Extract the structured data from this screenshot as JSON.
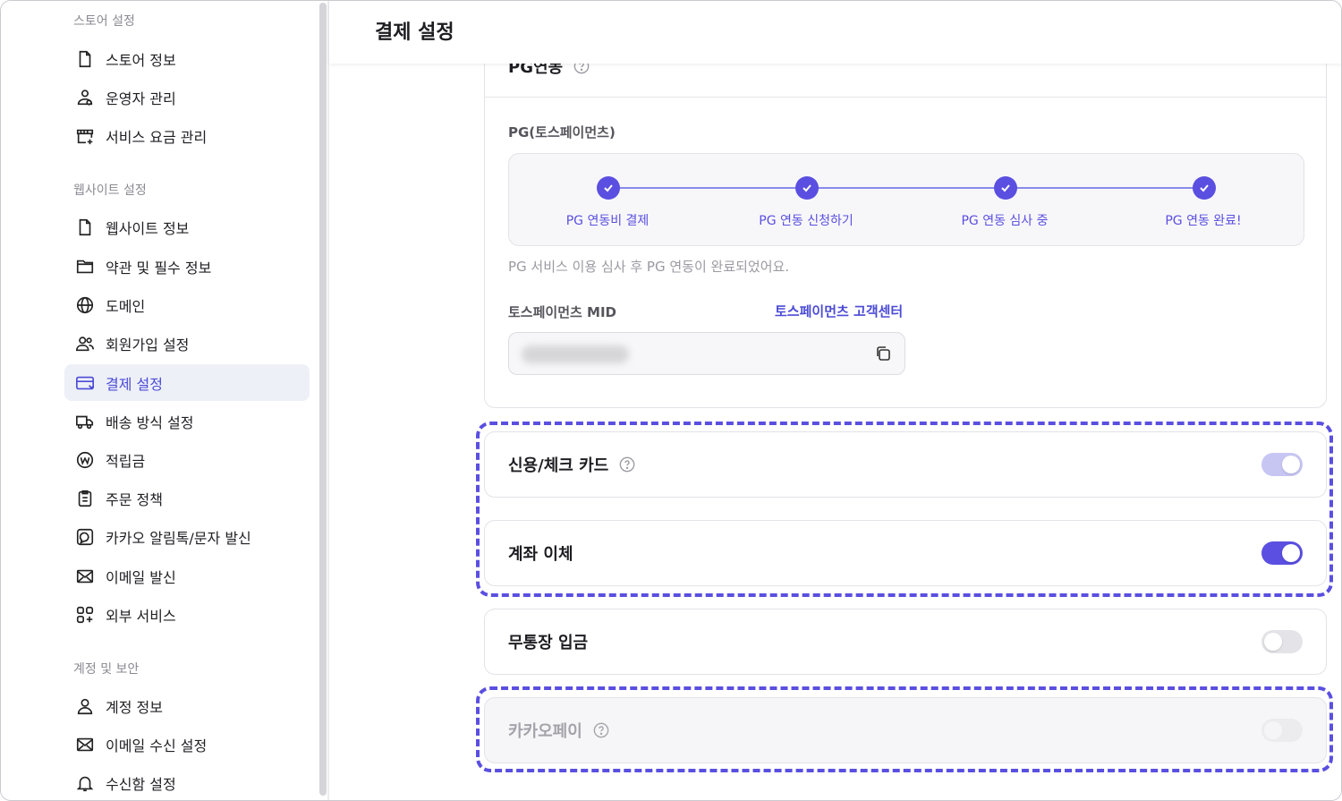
{
  "sidebar": {
    "sections": [
      {
        "title": "스토어 설정"
      },
      {
        "title": "웹사이트 설정"
      },
      {
        "title": "계정 및 보안"
      }
    ],
    "items": [
      {
        "label": "스토어 정보",
        "icon": "file-icon"
      },
      {
        "label": "운영자 관리",
        "icon": "user-group-icon"
      },
      {
        "label": "서비스 요금 관리",
        "icon": "store-plus-icon"
      },
      {
        "label": "웹사이트 정보",
        "icon": "file-icon"
      },
      {
        "label": "약관 및 필수 정보",
        "icon": "folder-icon"
      },
      {
        "label": "도메인",
        "icon": "globe-icon"
      },
      {
        "label": "회원가입 설정",
        "icon": "users-icon"
      },
      {
        "label": "결제 설정",
        "icon": "card-icon",
        "active": true
      },
      {
        "label": "배송 방식 설정",
        "icon": "truck-icon"
      },
      {
        "label": "적립금",
        "icon": "won-coin-icon"
      },
      {
        "label": "주문 정책",
        "icon": "clipboard-icon"
      },
      {
        "label": "카카오 알림톡/문자 발신",
        "icon": "chat-icon"
      },
      {
        "label": "이메일 발신",
        "icon": "mail-icon"
      },
      {
        "label": "외부 서비스",
        "icon": "apps-icon"
      },
      {
        "label": "계정 정보",
        "icon": "user-icon"
      },
      {
        "label": "이메일 수신 설정",
        "icon": "mail-icon"
      },
      {
        "label": "수신함 설정",
        "icon": "bell-icon"
      }
    ]
  },
  "header": {
    "title": "결제 설정"
  },
  "pg": {
    "title": "PG연동",
    "provider_label": "PG(토스페이먼츠)",
    "steps": [
      "PG 연동비 결제",
      "PG 연동 신청하기",
      "PG 연동 심사 중",
      "PG 연동 완료!"
    ],
    "note": "PG 서비스 이용 심사 후 PG 연동이 완료되었어요.",
    "mid_label": "토스페이먼츠 MID",
    "support_link": "토스페이먼츠 고객센터"
  },
  "methods": [
    {
      "label": "신용/체크 카드",
      "help": true,
      "state": "on-light"
    },
    {
      "label": "계좌 이체",
      "help": false,
      "state": "on"
    },
    {
      "label": "무통장 입금",
      "help": false,
      "state": "off"
    },
    {
      "label": "카카오페이",
      "help": true,
      "state": "disabled"
    }
  ],
  "colors": {
    "accent": "#5a4fe0",
    "active_bg": "#eef0f8",
    "highlight_dash": "#5a4fe0"
  }
}
